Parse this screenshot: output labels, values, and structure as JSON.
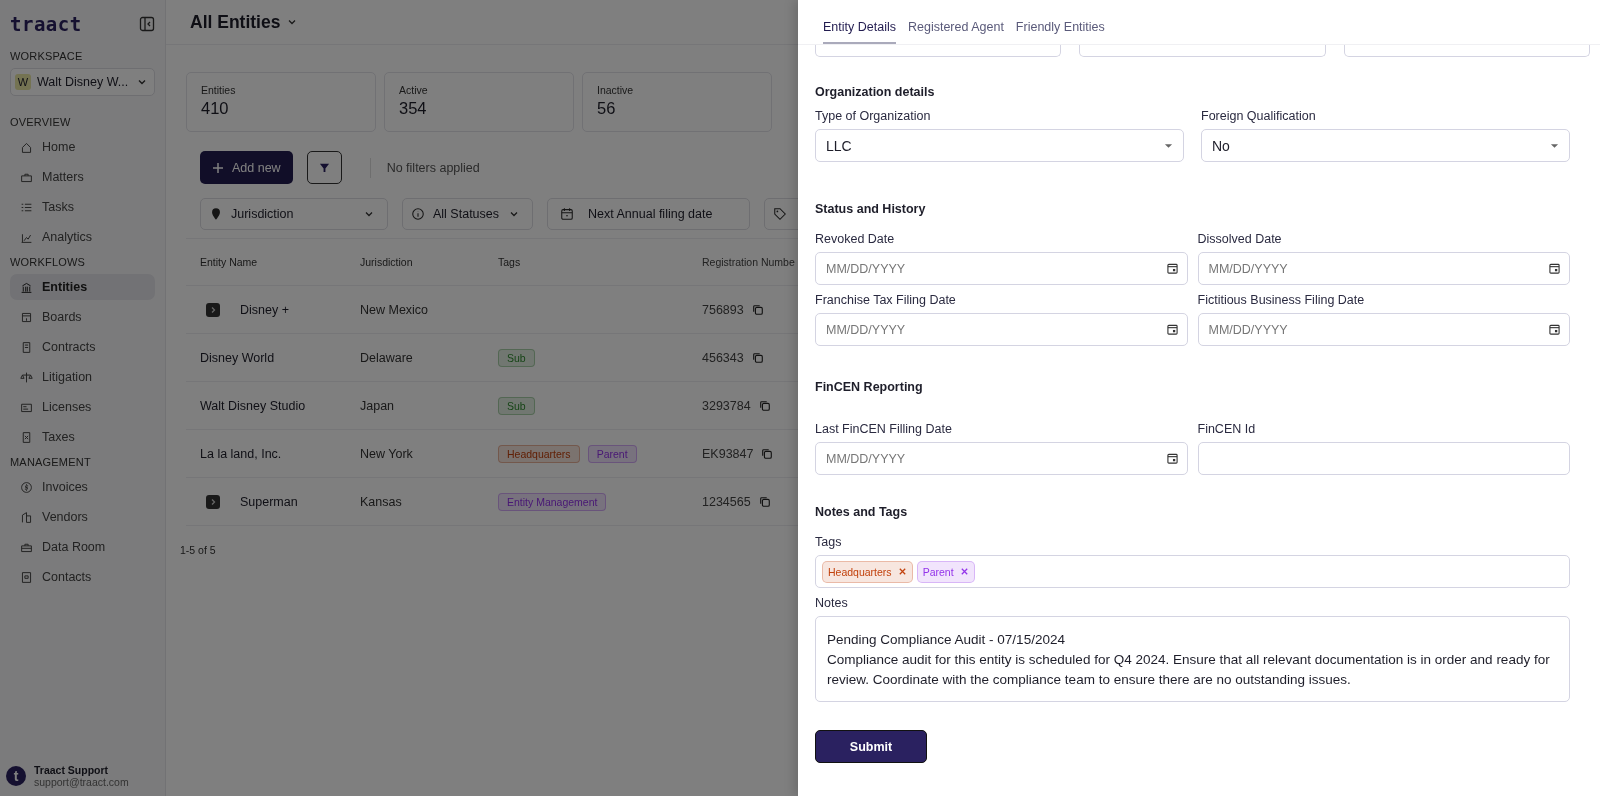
{
  "sidebar": {
    "logo": "traact",
    "workspace_label": "WORKSPACE",
    "workspace": {
      "initial": "W",
      "name": "Walt Disney W..."
    },
    "sections": [
      {
        "title": "OVERVIEW",
        "items": [
          {
            "label": "Home",
            "selected": false
          },
          {
            "label": "Matters",
            "selected": false
          },
          {
            "label": "Tasks",
            "selected": false
          },
          {
            "label": "Analytics",
            "selected": false
          }
        ]
      },
      {
        "title": "WORKFLOWS",
        "items": [
          {
            "label": "Entities",
            "selected": true
          },
          {
            "label": "Boards",
            "selected": false
          },
          {
            "label": "Contracts",
            "selected": false
          },
          {
            "label": "Litigation",
            "selected": false
          },
          {
            "label": "Licenses",
            "selected": false
          },
          {
            "label": "Taxes",
            "selected": false
          }
        ]
      },
      {
        "title": "MANAGEMENT",
        "items": [
          {
            "label": "Invoices",
            "selected": false
          },
          {
            "label": "Vendors",
            "selected": false
          },
          {
            "label": "Data Room",
            "selected": false
          },
          {
            "label": "Contacts",
            "selected": false
          }
        ]
      }
    ],
    "user": {
      "initial": "t",
      "name": "Traact Support",
      "email": "support@traact.com"
    }
  },
  "main": {
    "title": "All Entities",
    "stats": [
      {
        "label": "Entities",
        "value": "410"
      },
      {
        "label": "Active",
        "value": "354"
      },
      {
        "label": "Inactive",
        "value": "56"
      }
    ],
    "add_button": "Add new",
    "filter_status": "No filters applied",
    "filters": [
      {
        "kind": "dropdown",
        "label": "Jurisdiction"
      },
      {
        "kind": "dropdown",
        "label": "All Statuses"
      },
      {
        "kind": "date",
        "label": "Next Annual filing date"
      },
      {
        "kind": "cut"
      }
    ],
    "table": {
      "columns": [
        "Entity Name",
        "Jurisdiction",
        "Tags",
        "Registration Numbe"
      ],
      "rows": [
        {
          "name": "Disney +",
          "expandable": true,
          "jurisdiction": "New Mexico",
          "registration": "756893"
        },
        {
          "name": "Disney World",
          "expandable": false,
          "jurisdiction": "Delaware",
          "tags": [
            {
              "label": "Sub",
              "kind": "green"
            }
          ],
          "registration": "456343"
        },
        {
          "name": "Walt Disney Studio",
          "expandable": false,
          "jurisdiction": "Japan",
          "tags": [
            {
              "label": "Sub",
              "kind": "green"
            }
          ],
          "registration": "3293784"
        },
        {
          "name": "La la land, Inc.",
          "expandable": false,
          "jurisdiction": "New York",
          "tags": [
            {
              "label": "Headquarters",
              "kind": "orange"
            },
            {
              "label": "Parent",
              "kind": "purple"
            }
          ],
          "registration": "EK93847"
        },
        {
          "name": "Superman",
          "expandable": true,
          "jurisdiction": "Kansas",
          "tags": [
            {
              "label": "Entity Management",
              "kind": "purple"
            }
          ],
          "registration": "1234565"
        }
      ]
    },
    "pagination": "1-5 of 5"
  },
  "panel": {
    "tabs": [
      {
        "label": "Entity Details",
        "selected": true
      },
      {
        "label": "Registered Agent",
        "selected": false
      },
      {
        "label": "Friendly Entities",
        "selected": false
      }
    ],
    "partial_fields": [
      {
        "kind": "input"
      },
      {
        "kind": "input"
      },
      {
        "kind": "input"
      }
    ],
    "sections": [
      {
        "title": "Organization details",
        "fields": [
          {
            "kind": "select",
            "label": "Type of Organization",
            "value": "LLC"
          },
          {
            "kind": "select",
            "label": "Foreign Qualification",
            "value": "No"
          }
        ]
      },
      {
        "title": "Status and History",
        "fields": [
          {
            "kind": "date",
            "label": "Revoked Date",
            "placeholder": "MM/DD/YYYY"
          },
          {
            "kind": "date",
            "label": "Dissolved Date",
            "placeholder": "MM/DD/YYYY"
          },
          {
            "kind": "date",
            "label": "Franchise Tax Filing Date",
            "placeholder": "MM/DD/YYYY"
          },
          {
            "kind": "date",
            "label": "Fictitious Business Filing Date",
            "placeholder": "MM/DD/YYYY"
          }
        ]
      },
      {
        "title": "FinCEN Reporting",
        "fields": [
          {
            "kind": "date",
            "label": "Last FinCEN Filling Date",
            "placeholder": "MM/DD/YYYY"
          },
          {
            "kind": "text",
            "label": "FinCEN Id"
          }
        ]
      },
      {
        "title": "Notes and Tags",
        "fields": [
          {
            "kind": "tags",
            "label": "Tags",
            "tags": [
              {
                "label": "Headquarters",
                "color": "#c2410c"
              },
              {
                "label": "Parent",
                "color": "#9333ea"
              }
            ]
          },
          {
            "kind": "notes",
            "label": "Notes",
            "lines": [
              "Pending Compliance Audit - 07/15/2024",
              "Compliance audit for this entity is scheduled for Q4 2024. Ensure that all relevant documentation is in order and ready for review. Coordinate with the compliance team to ensure there are no outstanding issues."
            ]
          }
        ]
      }
    ],
    "submit": "Submit"
  }
}
